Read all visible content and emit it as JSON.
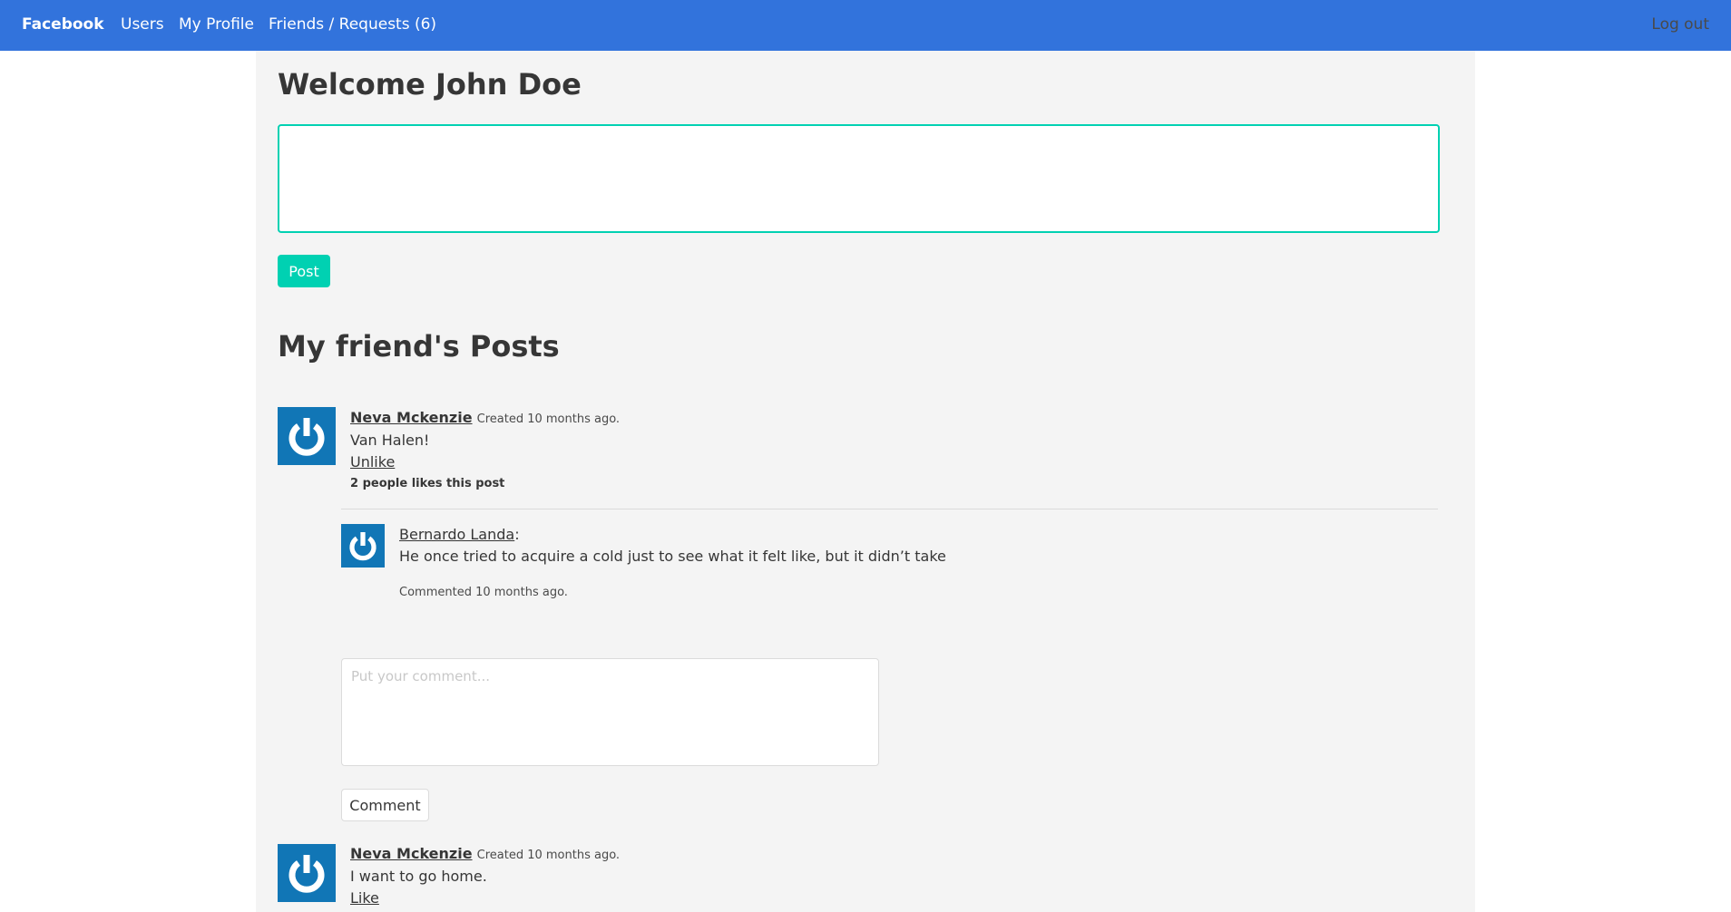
{
  "nav": {
    "brand": "Facebook",
    "users": "Users",
    "profile": "My Profile",
    "friends": "Friends / Requests (6)",
    "logout": "Log out"
  },
  "welcome": "Welcome John Doe",
  "post_form": {
    "value": "",
    "button": "Post"
  },
  "section_title": "My friend's Posts",
  "colors": {
    "navbar": "#3273dc",
    "primary": "#00d1b2",
    "avatar": "#1176b6"
  },
  "posts": [
    {
      "author": "Neva Mckenzie",
      "created": "Created 10 months ago.",
      "text": "Van Halen!",
      "like_action": "Unlike",
      "likes": "2 people likes this post",
      "comments": [
        {
          "author": "Bernardo Landa",
          "separator": ":",
          "text": "He once tried to acquire a cold just to see what it felt like, but it didn’t take",
          "meta": "Commented 10 months ago."
        }
      ],
      "comment_form": {
        "placeholder": "Put your comment...",
        "button": "Comment"
      }
    },
    {
      "author": "Neva Mckenzie",
      "created": "Created 10 months ago.",
      "text": "I want to go home.",
      "like_action": "Like"
    }
  ]
}
